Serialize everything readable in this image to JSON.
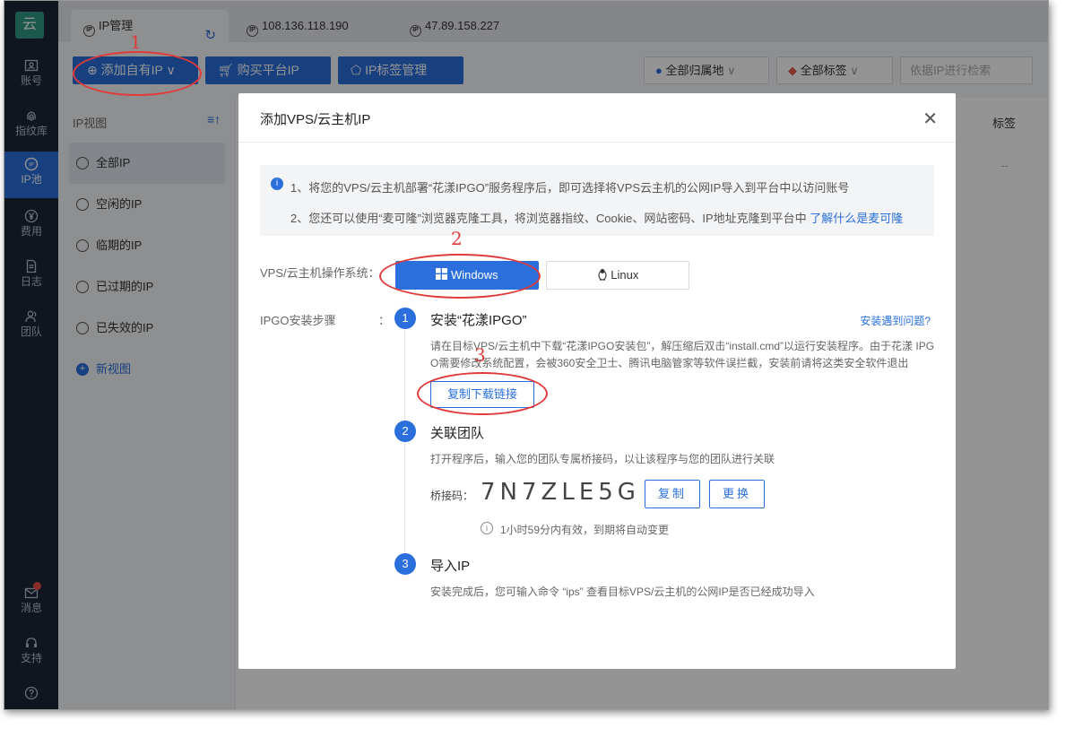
{
  "sidebar": {
    "logo": "云",
    "items": [
      {
        "label": "账号",
        "icon": "id-card-icon"
      },
      {
        "label": "指纹库",
        "icon": "fingerprint-icon"
      },
      {
        "label": "IP池",
        "icon": "ip-icon"
      },
      {
        "label": "费用",
        "icon": "yen-icon"
      },
      {
        "label": "日志",
        "icon": "document-icon"
      },
      {
        "label": "团队",
        "icon": "team-icon"
      },
      {
        "label": "消息",
        "icon": "mail-icon"
      },
      {
        "label": "支持",
        "icon": "headset-icon"
      }
    ]
  },
  "tabs": [
    {
      "label": "IP管理",
      "active": true
    },
    {
      "label": "108.136.118.190"
    },
    {
      "label": "47.89.158.227"
    }
  ],
  "toolbar": {
    "add_ip": "添加自有IP",
    "buy_ip": "购买平台IP",
    "tag_manage": "IP标签管理",
    "region_filter": "全部归属地",
    "tag_filter": "全部标签",
    "search_placeholder": "依据IP进行检索"
  },
  "ipview": {
    "title": "IP视图",
    "items": [
      "全部IP",
      "空闲的IP",
      "临期的IP",
      "已过期的IP",
      "已失效的IP"
    ],
    "new_view": "新视图"
  },
  "table": {
    "tag_col": "标签",
    "empty_cell": "--"
  },
  "modal": {
    "title": "添加VPS/云主机IP",
    "notice_1": "1、将您的VPS/云主机部署“花漾IPGO”服务程序后，即可选择将VPS云主机的公网IP导入到平台中以访问账号",
    "notice_2": "2、您还可以使用“麦可隆”浏览器克隆工具，将浏览器指纹、Cookie、网站密码、IP地址克隆到平台中",
    "notice_link": "了解什么是麦可隆",
    "os_label": "VPS/云主机操作系统：",
    "os_windows": "Windows",
    "os_linux": "Linux",
    "steps_label": "IPGO安装步骤",
    "steps_colon": "：",
    "help_link": "安装遇到问题?",
    "step1": {
      "num": "1",
      "title": "安装“花漾IPGO”",
      "desc_1": "请在目标VPS/云主机中下载“花漾IPGO安装包”，解压缩后双击“install.cmd”以运行安装程序。由于花漾 IPG",
      "desc_2": "O需要修改系统配置，会被360安全卫士、腾讯电脑管家等软件误拦截，安装前请将这类安全软件退出",
      "button": "复制下载链接"
    },
    "step2": {
      "num": "2",
      "title": "关联团队",
      "desc": "打开程序后，输入您的团队专属桥接码，以让该程序与您的团队进行关联",
      "code_label": "桥接码：",
      "code": "7N7ZLE5G",
      "copy": "复制",
      "change": "更换",
      "validity": "1小时59分内有效，到期将自动变更"
    },
    "step3": {
      "num": "3",
      "title": "导入IP",
      "desc": "安装完成后，您可输入命令 “ips” 查看目标VPS/云主机的公网IP是否已经成功导入"
    }
  },
  "annotations": [
    "1",
    "2",
    "3"
  ]
}
